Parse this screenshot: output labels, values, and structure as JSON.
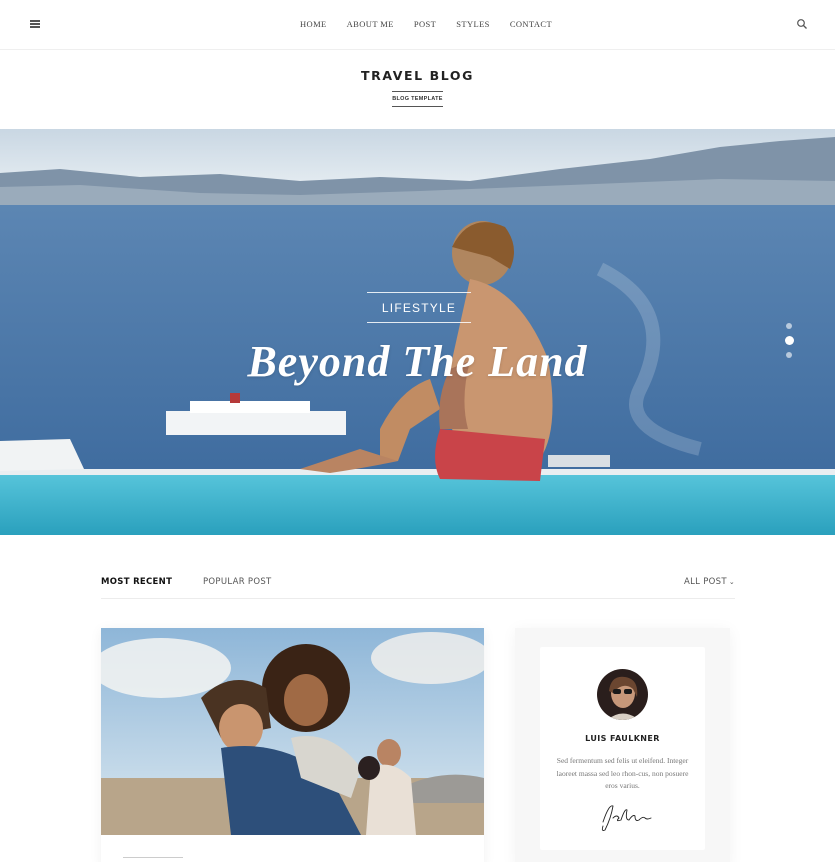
{
  "nav": {
    "items": [
      "HOME",
      "ABOUT ME",
      "POST",
      "STYLES",
      "CONTACT"
    ]
  },
  "brand": {
    "title": "TRAVEL BLOG",
    "subtitle": "BLOG TEMPLATE"
  },
  "hero": {
    "category": "LIFESTYLE",
    "title": "Beyond The Land",
    "slide_count": 3,
    "active_slide": 2
  },
  "tabs": {
    "recent": "MOST RECENT",
    "popular": "POPULAR POST",
    "all": "ALL POST",
    "all_icon": "chevron-down-icon"
  },
  "author": {
    "name": "LUIS FAULKNER",
    "bio": "Sed fermentum sed felis ut eleifend. Integer laoreet massa sed leo rhon-cus, non posuere eros varius."
  },
  "icons": {
    "menu": "hamburger-menu-icon",
    "search": "search-icon"
  },
  "colors": {
    "sea": "#4a77a8",
    "pool": "#3fb4cf",
    "sky": "#dfe8ef",
    "text_dark": "#222222"
  }
}
